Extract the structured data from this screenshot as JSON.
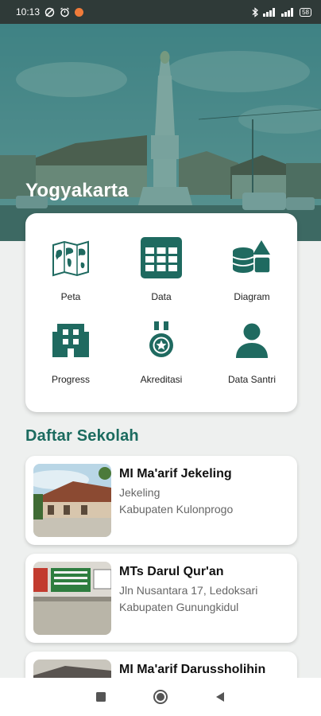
{
  "status_bar": {
    "time": "10:13",
    "battery": "58"
  },
  "hero": {
    "title": "Yogyakarta"
  },
  "menu": [
    {
      "label": "Peta",
      "icon": "world-map-icon"
    },
    {
      "label": "Data",
      "icon": "table-icon"
    },
    {
      "label": "Diagram",
      "icon": "database-shapes-icon"
    },
    {
      "label": "Progress",
      "icon": "building-icon"
    },
    {
      "label": "Akreditasi",
      "icon": "medal-icon"
    },
    {
      "label": "Data Santri",
      "icon": "person-icon"
    }
  ],
  "section_title": "Daftar Sekolah",
  "schools": [
    {
      "name": "MI Ma'arif Jekeling",
      "address": "Jekeling",
      "city": "Kabupaten Kulonprogo"
    },
    {
      "name": "MTs Darul Qur'an",
      "address": "Jln Nusantara 17, Ledoksari",
      "city": "Kabupaten Gunungkidul"
    },
    {
      "name": "MI Ma'arif Darussholihin",
      "address": "",
      "city": ""
    }
  ],
  "colors": {
    "accent": "#1b6b5f",
    "icon": "#1f6a60"
  }
}
